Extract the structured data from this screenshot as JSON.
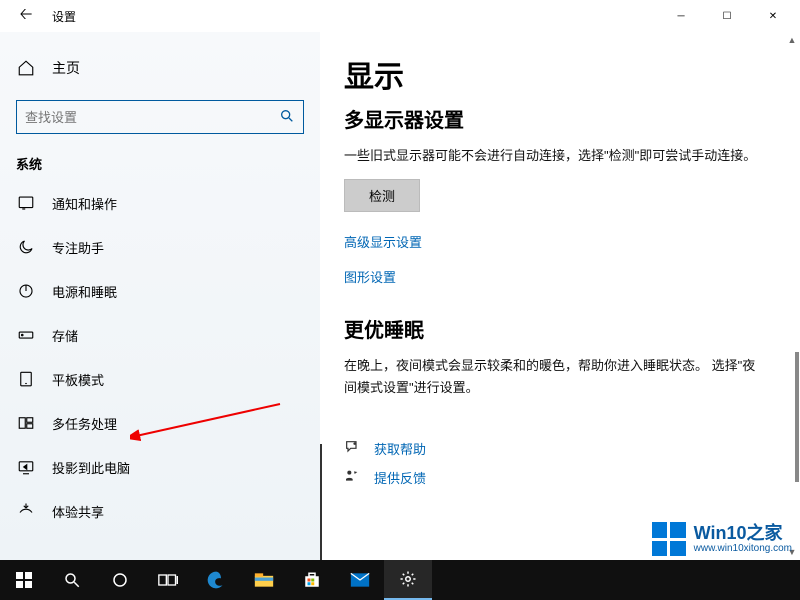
{
  "titlebar": {
    "title": "设置"
  },
  "sidebar": {
    "home": "主页",
    "search_placeholder": "查找设置",
    "group": "系统",
    "items": [
      {
        "label": "通知和操作"
      },
      {
        "label": "专注助手"
      },
      {
        "label": "电源和睡眠"
      },
      {
        "label": "存储"
      },
      {
        "label": "平板模式"
      },
      {
        "label": "多任务处理"
      },
      {
        "label": "投影到此电脑"
      },
      {
        "label": "体验共享"
      }
    ]
  },
  "content": {
    "h1": "显示",
    "h2a": "多显示器设置",
    "desc_a": "一些旧式显示器可能不会进行自动连接，选择\"检测\"即可尝试手动连接。",
    "detect_btn": "检测",
    "link_adv": "高级显示设置",
    "link_gfx": "图形设置",
    "h2b": "更优睡眠",
    "desc_b": "在晚上，夜间模式会显示较柔和的暖色，帮助你进入睡眠状态。 选择\"夜间模式设置\"进行设置。",
    "help": "获取帮助",
    "feedback": "提供反馈"
  },
  "watermark": {
    "line1": "Win10之家",
    "line2": "www.win10xitong.com"
  }
}
